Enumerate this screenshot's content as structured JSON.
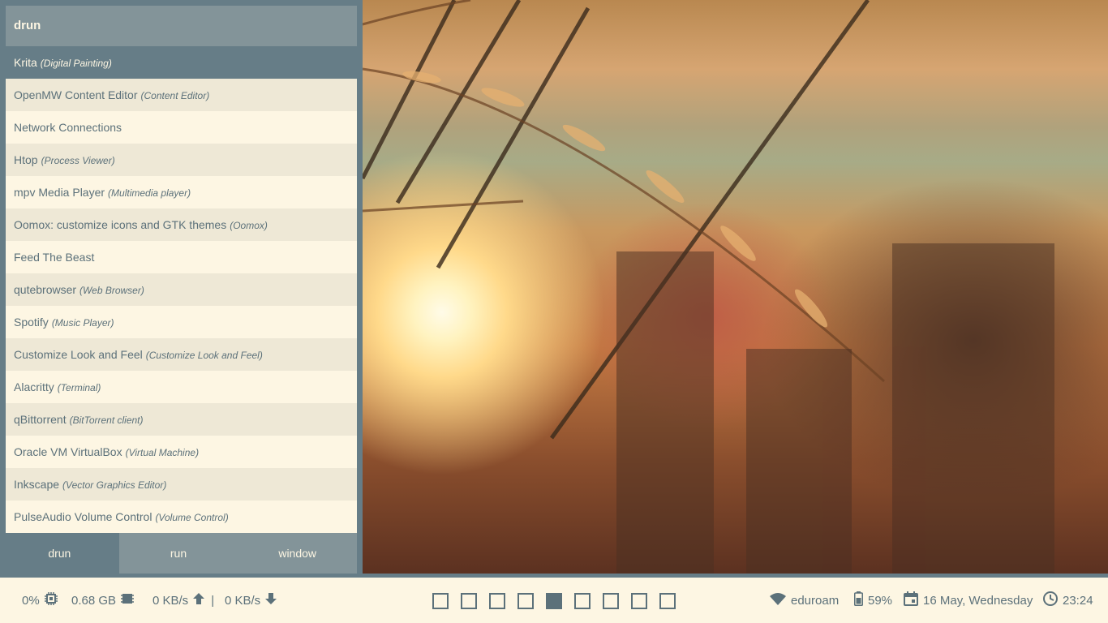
{
  "launcher": {
    "prompt": "drun",
    "entries": [
      {
        "name": "Krita",
        "generic": "(Digital Painting)",
        "selected": true
      },
      {
        "name": "OpenMW Content Editor",
        "generic": "(Content Editor)"
      },
      {
        "name": "Network Connections",
        "generic": ""
      },
      {
        "name": "Htop",
        "generic": "(Process Viewer)"
      },
      {
        "name": "mpv Media Player",
        "generic": "(Multimedia player)"
      },
      {
        "name": "Oomox: customize icons and GTK themes",
        "generic": "(Oomox)"
      },
      {
        "name": "Feed The Beast",
        "generic": ""
      },
      {
        "name": "qutebrowser",
        "generic": "(Web Browser)"
      },
      {
        "name": "Spotify",
        "generic": "(Music Player)"
      },
      {
        "name": "Customize Look and Feel",
        "generic": "(Customize Look and Feel)"
      },
      {
        "name": "Alacritty",
        "generic": "(Terminal)"
      },
      {
        "name": "qBittorrent",
        "generic": "(BitTorrent client)"
      },
      {
        "name": "Oracle VM VirtualBox",
        "generic": "(Virtual Machine)"
      },
      {
        "name": "Inkscape",
        "generic": "(Vector Graphics Editor)"
      },
      {
        "name": "PulseAudio Volume Control",
        "generic": "(Volume Control)"
      }
    ],
    "modes": [
      {
        "label": "drun",
        "active": true
      },
      {
        "label": "run",
        "active": false
      },
      {
        "label": "window",
        "active": false
      }
    ]
  },
  "bar": {
    "cpu": "0%",
    "memory": "0.68 GB",
    "upload": "0 KB/s",
    "separator": "|",
    "download": "0 KB/s",
    "workspaces": {
      "count": 9,
      "active_index": 4
    },
    "wifi": "eduroam",
    "battery": "59%",
    "date": "16 May, Wednesday",
    "time": "23:24"
  },
  "icons": {
    "cpu": "cpu-icon",
    "memory": "memory-icon",
    "upload": "arrow-up-icon",
    "download": "arrow-down-icon",
    "wifi": "wifi-icon",
    "battery": "battery-icon",
    "calendar": "calendar-icon",
    "clock": "clock-icon"
  },
  "colors": {
    "accent": "#667d87",
    "prompt_bg": "#839499",
    "row_light": "#fdf6e3",
    "row_dark": "#eee8d6",
    "text": "#5c717a"
  }
}
